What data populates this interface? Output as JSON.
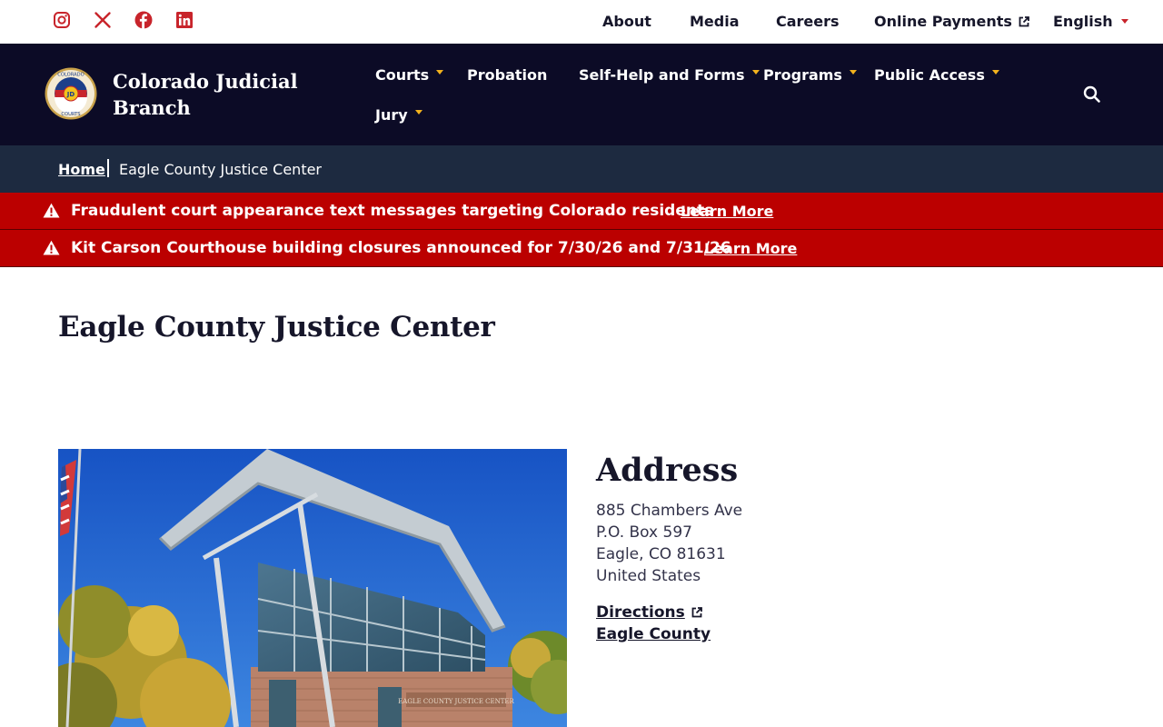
{
  "colors": {
    "navy": "#0c0b26",
    "crumb_bg": "#1d2a40",
    "alert_red": "#bb0000",
    "accent_gold": "#f2b21d",
    "social_red": "#c8242b"
  },
  "utility": {
    "social": [
      {
        "icon": "instagram-icon"
      },
      {
        "icon": "x-icon"
      },
      {
        "icon": "facebook-icon"
      },
      {
        "icon": "linkedin-icon"
      }
    ],
    "links": {
      "about": "About",
      "media": "Media",
      "careers": "Careers",
      "payments": "Online Payments",
      "language": "English"
    }
  },
  "brand": {
    "name_line1": "Colorado Judicial",
    "name_line2": "Branch",
    "seal_text_top": "COLORADO",
    "seal_text_bottom": "COURTS",
    "seal_center": "JD"
  },
  "nav": {
    "courts": "Courts",
    "probation": "Probation",
    "self_help": "Self-Help and Forms",
    "programs": "Programs",
    "public_access": "Public Access",
    "jury": "Jury"
  },
  "breadcrumb": {
    "home": "Home",
    "current": "Eagle County Justice Center"
  },
  "alerts": [
    {
      "text": "Fraudulent court appearance text messages targeting Colorado residents",
      "link": "Learn More"
    },
    {
      "text": "Kit Carson Courthouse building closures announced for 7/30/26 and 7/31/26",
      "link": "Learn More"
    }
  ],
  "page": {
    "title": "Eagle County Justice Center",
    "building_sign": "EAGLE COUNTY JUSTICE CENTER"
  },
  "address": {
    "heading": "Address",
    "street": "885 Chambers Ave",
    "po_box": "P.O. Box 597",
    "city_line": "Eagle, CO 81631",
    "country": "United States",
    "directions": "Directions",
    "county": "Eagle County"
  }
}
